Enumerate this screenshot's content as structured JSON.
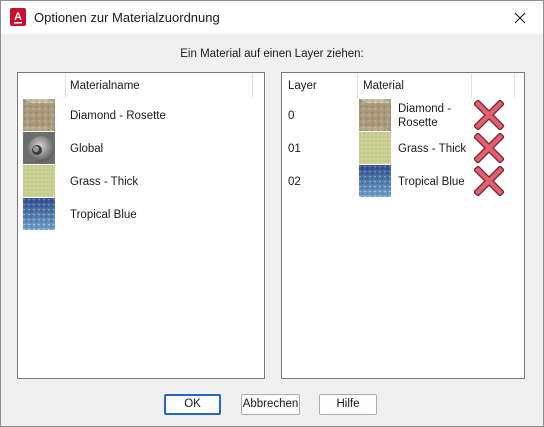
{
  "window": {
    "title": "Optionen zur Materialzuordnung"
  },
  "instruction": "Ein Material auf einen Layer ziehen:",
  "materials": {
    "column_header": "Materialname",
    "items": [
      {
        "name": "Diamond - Rosette",
        "icon": "diamond-rosette-swatch-icon"
      },
      {
        "name": "Global",
        "icon": "global-sphere-swatch-icon"
      },
      {
        "name": "Grass - Thick",
        "icon": "grass-thick-swatch-icon"
      },
      {
        "name": "Tropical Blue",
        "icon": "tropical-blue-swatch-icon"
      }
    ]
  },
  "assignments": {
    "column_layer": "Layer",
    "column_material": "Material",
    "rows": [
      {
        "layer": "0",
        "material_line1": "Diamond -",
        "material_line2": "Rosette",
        "remove_icon": "remove-x-icon"
      },
      {
        "layer": "01",
        "material_line1": "Grass - Thick",
        "material_line2": "",
        "remove_icon": "remove-x-icon"
      },
      {
        "layer": "02",
        "material_line1": "Tropical Blue",
        "material_line2": "",
        "remove_icon": "remove-x-icon"
      }
    ]
  },
  "buttons": {
    "ok": "OK",
    "cancel": "Abbrechen",
    "help": "Hilfe"
  },
  "colors": {
    "app_icon": "#c8102e",
    "remove_x": "#e06070",
    "ok_border": "#2466c6"
  }
}
